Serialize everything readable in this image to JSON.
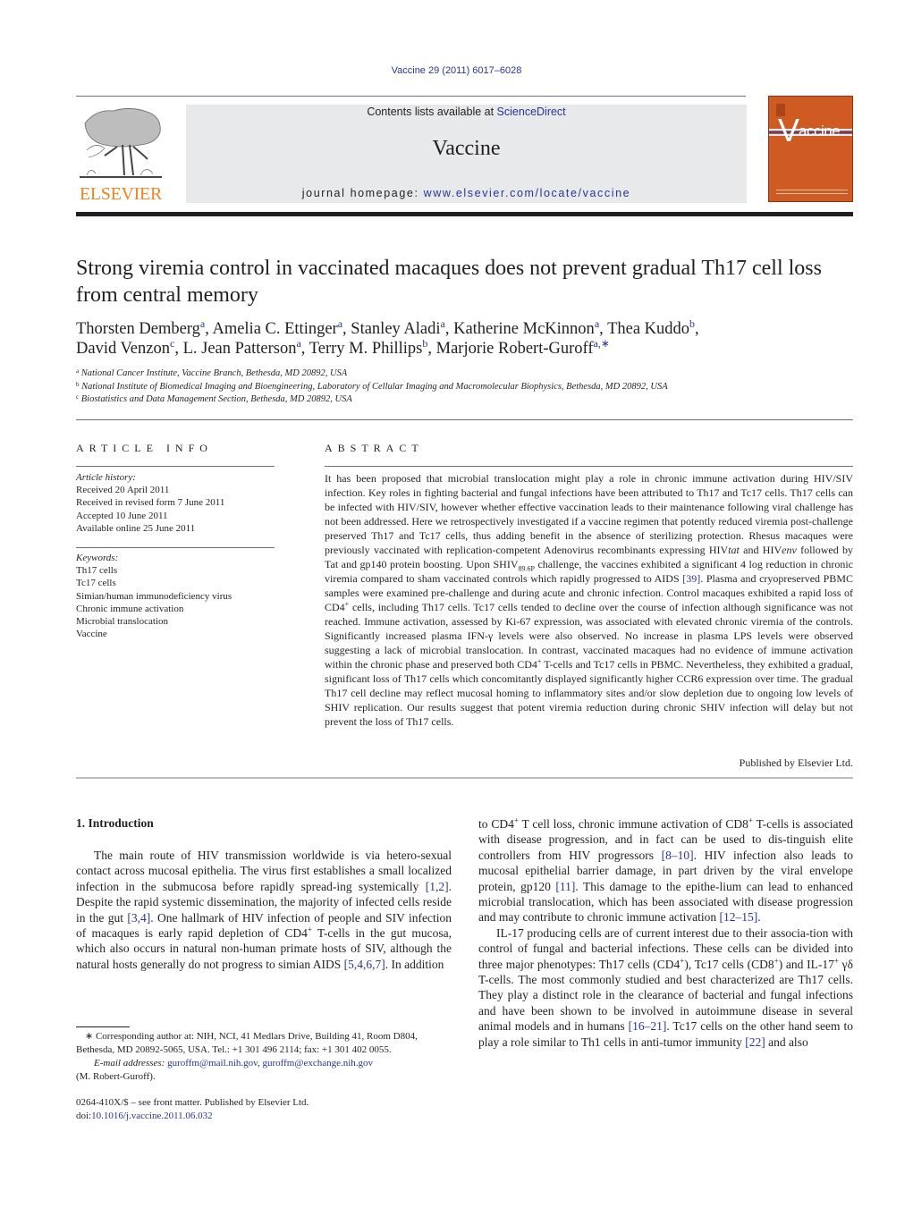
{
  "header": {
    "citation": "Vaccine 29 (2011) 6017–6028",
    "contents_prefix": "Contents lists available at ",
    "contents_link": "ScienceDirect",
    "journal_name": "Vaccine",
    "homepage_prefix": "journal homepage: ",
    "homepage_link": "www.elsevier.com/locate/vaccine",
    "publisher_logo_text": "ELSEVIER",
    "cover_title": "accine",
    "cover_v": "V",
    "colors": {
      "elsevier_orange": "#f5821f",
      "cover_orange": "#cf5a22",
      "link_blue": "#2a3590",
      "band_gray": "#e8e9ea"
    }
  },
  "article": {
    "title": "Strong viremia control in vaccinated macaques does not prevent gradual Th17 cell loss from central memory",
    "authors": [
      {
        "name": "Thorsten Demberg",
        "aff": "a",
        "sep": ", "
      },
      {
        "name": "Amelia C. Ettinger",
        "aff": "a",
        "sep": ", "
      },
      {
        "name": "Stanley Aladi",
        "aff": "a",
        "sep": ", "
      },
      {
        "name": "Katherine McKinnon",
        "aff": "a",
        "sep": ", "
      },
      {
        "name": "Thea Kuddo",
        "aff": "b",
        "sep": ","
      },
      {
        "name": "David Venzon",
        "aff": "c",
        "sep": ", "
      },
      {
        "name": "L. Jean Patterson",
        "aff": "a",
        "sep": ", "
      },
      {
        "name": "Terry M. Phillips",
        "aff": "b",
        "sep": ", "
      },
      {
        "name": "Marjorie Robert-Guroff",
        "aff": "a,∗",
        "sep": ""
      }
    ],
    "affiliations": [
      {
        "key": "a",
        "text": "National Cancer Institute, Vaccine Branch, Bethesda, MD 20892, USA"
      },
      {
        "key": "b",
        "text": "National Institute of Biomedical Imaging and Bioengineering, Laboratory of Cellular Imaging and Macromolecular Biophysics, Bethesda, MD 20892, USA"
      },
      {
        "key": "c",
        "text": "Biostatistics and Data Management Section, Bethesda, MD 20892, USA"
      }
    ]
  },
  "article_info": {
    "heading": "ARTICLE INFO",
    "history_label": "Article history:",
    "history": [
      "Received 20 April 2011",
      "Received in revised form 7 June 2011",
      "Accepted 10 June 2011",
      "Available online 25 June 2011"
    ],
    "keywords_label": "Keywords:",
    "keywords": [
      "Th17 cells",
      "Tc17 cells",
      "Simian/human immunodeficiency virus",
      "Chronic immune activation",
      "Microbial translocation",
      "Vaccine"
    ]
  },
  "abstract": {
    "heading": "ABSTRACT",
    "p1": "It has been proposed that microbial translocation might play a role in chronic immune activation during HIV/SIV infection. Key roles in fighting bacterial and fungal infections have been attributed to Th17 and Tc17 cells. Th17 cells can be infected with HIV/SIV, however whether effective vaccination leads to their maintenance following viral challenge has not been addressed. Here we retrospectively investigated if a vaccine regimen that potently reduced viremia post-challenge preserved Th17 and Tc17 cells, thus adding benefit in the absence of sterilizing protection. Rhesus macaques were previously vaccinated with replication-competent Adenovirus recombinants expressing HIV",
    "tat": "tat",
    "and_hiv": " and HIV",
    "env": "env",
    "p2": " followed by Tat and gp140 protein boosting. Upon SHIV",
    "shiv_sub": "89.6P",
    "p3": " challenge, the vaccines exhibited a significant 4 log reduction in chronic viremia compared to sham vaccinated controls which rapidly progressed to AIDS ",
    "ref39": "[39]",
    "p4": ". Plasma and cryopreserved PBMC samples were examined pre-challenge and during acute and chronic infection. Control macaques exhibited a rapid loss of CD4",
    "plus": "+",
    "p5": " cells, including Th17 cells. Tc17 cells tended to decline over the course of infection although significance was not reached. Immune activation, assessed by Ki-67 expression, was associated with elevated chronic viremia of the controls. Significantly increased plasma IFN-γ levels were also observed. No increase in plasma LPS levels were observed suggesting a lack of microbial translocation. In contrast, vaccinated macaques had no evidence of immune activation within the chronic phase and preserved both CD4",
    "p6": " T-cells and Tc17 cells in PBMC. Nevertheless, they exhibited a gradual, significant loss of Th17 cells which concomitantly displayed significantly higher CCR6 expression over time. The gradual Th17 cell decline may reflect mucosal homing to inflammatory sites and/or slow depletion due to ongoing low levels of SHIV replication. Our results suggest that potent viremia reduction during chronic SHIV infection will delay but not prevent the loss of Th17 cells.",
    "publisher": "Published by Elsevier Ltd."
  },
  "body": {
    "intro_heading": "1.  Introduction",
    "left": {
      "s1": "The main route of HIV transmission worldwide is via hetero-sexual contact across mucosal epithelia. The virus first establishes a small localized infection in the submucosa before rapidly spread-ing systemically ",
      "r1": "[1,2]",
      "s2": ". Despite the rapid systemic dissemination, the majority of infected cells reside in the gut ",
      "r2": "[3,4]",
      "s3": ". One hallmark of HIV infection of people and SIV infection of macaques is early rapid depletion of CD4",
      "s4": " T-cells in the gut mucosa, which also occurs in natural non-human primate hosts of SIV, although the natural hosts generally do not progress to simian AIDS ",
      "r3": "[5,4,6,7]",
      "s5": ". In addition"
    },
    "right": {
      "a1": "to CD4",
      "a2": " T cell loss, chronic immune activation of CD8",
      "a3": " T-cells is associated with disease progression, and in fact can be used to dis-tinguish elite controllers from HIV progressors ",
      "ra1": "[8–10]",
      "a4": ". HIV infection also leads to mucosal epithelial barrier damage, in part driven by the viral envelope protein, gp120 ",
      "ra2": "[11]",
      "a5": ". This damage to the epithe-lium can lead to enhanced microbial translocation, which has been associated with disease progression and may contribute to chronic immune activation ",
      "ra3": "[12–15]",
      "a6": ".",
      "b1": "IL-17 producing cells are of current interest due to their associa-tion with control of fungal and bacterial infections. These cells can be divided into three major phenotypes: Th17 cells (CD4",
      "b2": "), Tc17 cells (CD8",
      "b3": ") and IL-17",
      "b4": " γδ T-cells. The most commonly studied and best characterized are Th17 cells. They play a distinct role in the clearance of bacterial and fungal infections and have been shown to be involved in autoimmune disease in several animal models and in humans ",
      "rb1": "[16–21]",
      "b5": ". Tc17 cells on the other hand seem to play a role similar to Th1 cells in anti-tumor immunity ",
      "rb2": "[22]",
      "b6": " and also"
    }
  },
  "footnotes": {
    "corresponding": "∗ Corresponding author at: NIH, NCI, 41 Medlars Drive, Building 41, Room D804, Bethesda, MD 20892-5065, USA. Tel.: +1 301 496 2114; fax: +1 301 402 0055.",
    "email_label": "E-mail addresses:",
    "email1": "guroffm@mail.nih.gov",
    "email_sep": ", ",
    "email2": "guroffm@exchange.nih.gov",
    "email_owner": "(M. Robert-Guroff).",
    "front_matter": "0264-410X/$ – see front matter. Published by Elsevier Ltd.",
    "doi_label": "doi:",
    "doi": "10.1016/j.vaccine.2011.06.032"
  }
}
